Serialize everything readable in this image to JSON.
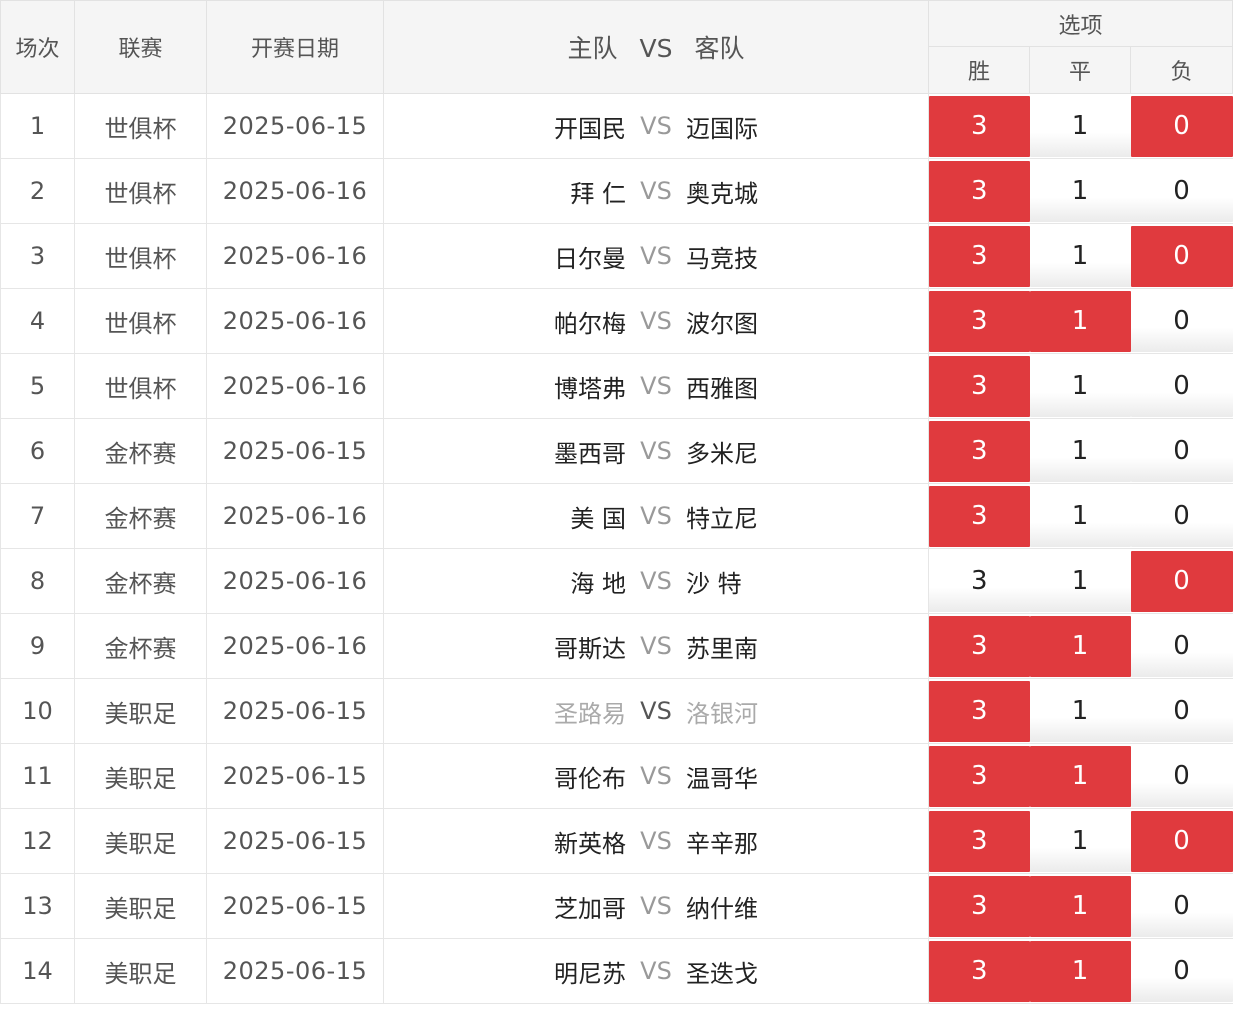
{
  "header": {
    "num": "场次",
    "league": "联赛",
    "date": "开赛日期",
    "home": "主队",
    "vs": "VS",
    "away": "客队",
    "options": "选项",
    "win": "胜",
    "draw": "平",
    "lose": "负"
  },
  "colors": {
    "selected": "#e03a3e",
    "header_bg": "#f5f5f5"
  },
  "rows": [
    {
      "num": "1",
      "league": "世俱杯",
      "date": "2025-06-15",
      "home": "开国民",
      "vs": "VS",
      "away": "迈国际",
      "w": "3",
      "d": "1",
      "l": "0",
      "sw": true,
      "sd": false,
      "sl": true
    },
    {
      "num": "2",
      "league": "世俱杯",
      "date": "2025-06-16",
      "home": "拜 仁",
      "vs": "VS",
      "away": "奥克城",
      "w": "3",
      "d": "1",
      "l": "0",
      "sw": true,
      "sd": false,
      "sl": false
    },
    {
      "num": "3",
      "league": "世俱杯",
      "date": "2025-06-16",
      "home": "日尔曼",
      "vs": "VS",
      "away": "马竞技",
      "w": "3",
      "d": "1",
      "l": "0",
      "sw": true,
      "sd": false,
      "sl": true
    },
    {
      "num": "4",
      "league": "世俱杯",
      "date": "2025-06-16",
      "home": "帕尔梅",
      "vs": "VS",
      "away": "波尔图",
      "w": "3",
      "d": "1",
      "l": "0",
      "sw": true,
      "sd": true,
      "sl": false
    },
    {
      "num": "5",
      "league": "世俱杯",
      "date": "2025-06-16",
      "home": "博塔弗",
      "vs": "VS",
      "away": "西雅图",
      "w": "3",
      "d": "1",
      "l": "0",
      "sw": true,
      "sd": false,
      "sl": false
    },
    {
      "num": "6",
      "league": "金杯赛",
      "date": "2025-06-15",
      "home": "墨西哥",
      "vs": "VS",
      "away": "多米尼",
      "w": "3",
      "d": "1",
      "l": "0",
      "sw": true,
      "sd": false,
      "sl": false
    },
    {
      "num": "7",
      "league": "金杯赛",
      "date": "2025-06-16",
      "home": "美 国",
      "vs": "VS",
      "away": "特立尼",
      "w": "3",
      "d": "1",
      "l": "0",
      "sw": true,
      "sd": false,
      "sl": false
    },
    {
      "num": "8",
      "league": "金杯赛",
      "date": "2025-06-16",
      "home": "海 地",
      "vs": "VS",
      "away": "沙 特",
      "w": "3",
      "d": "1",
      "l": "0",
      "sw": false,
      "sd": false,
      "sl": true
    },
    {
      "num": "9",
      "league": "金杯赛",
      "date": "2025-06-16",
      "home": "哥斯达",
      "vs": "VS",
      "away": "苏里南",
      "w": "3",
      "d": "1",
      "l": "0",
      "sw": true,
      "sd": true,
      "sl": false
    },
    {
      "num": "10",
      "league": "美职足",
      "date": "2025-06-15",
      "home": "圣路易",
      "vs": "VS",
      "away": "洛银河",
      "w": "3",
      "d": "1",
      "l": "0",
      "sw": true,
      "sd": false,
      "sl": false,
      "dim": true
    },
    {
      "num": "11",
      "league": "美职足",
      "date": "2025-06-15",
      "home": "哥伦布",
      "vs": "VS",
      "away": "温哥华",
      "w": "3",
      "d": "1",
      "l": "0",
      "sw": true,
      "sd": true,
      "sl": false
    },
    {
      "num": "12",
      "league": "美职足",
      "date": "2025-06-15",
      "home": "新英格",
      "vs": "VS",
      "away": "辛辛那",
      "w": "3",
      "d": "1",
      "l": "0",
      "sw": true,
      "sd": false,
      "sl": true
    },
    {
      "num": "13",
      "league": "美职足",
      "date": "2025-06-15",
      "home": "芝加哥",
      "vs": "VS",
      "away": "纳什维",
      "w": "3",
      "d": "1",
      "l": "0",
      "sw": true,
      "sd": true,
      "sl": false
    },
    {
      "num": "14",
      "league": "美职足",
      "date": "2025-06-15",
      "home": "明尼苏",
      "vs": "VS",
      "away": "圣迭戈",
      "w": "3",
      "d": "1",
      "l": "0",
      "sw": true,
      "sd": true,
      "sl": false
    }
  ]
}
